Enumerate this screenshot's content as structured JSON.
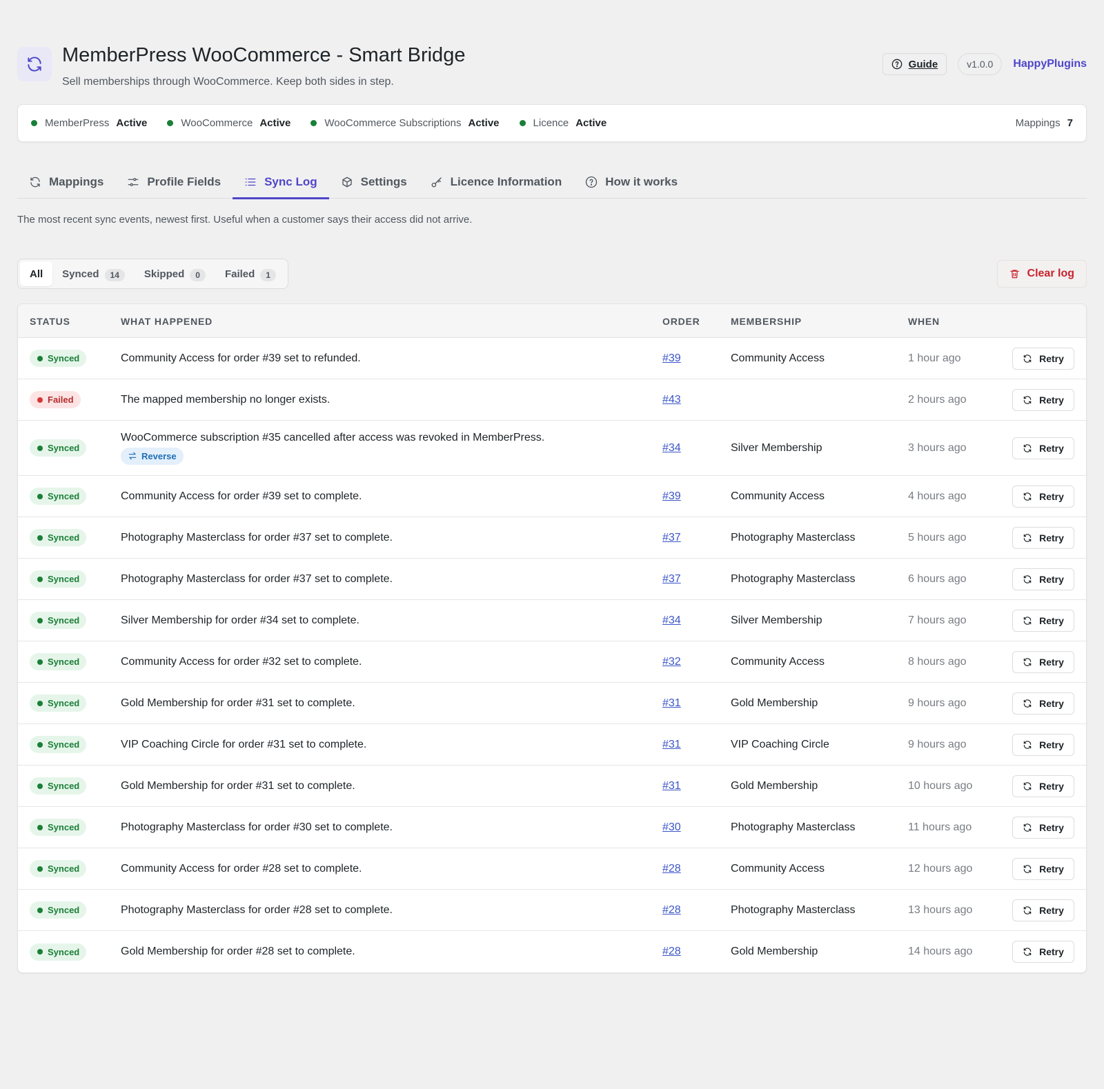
{
  "header": {
    "title": "MemberPress WooCommerce - Smart Bridge",
    "subtitle": "Sell memberships through WooCommerce. Keep both sides in step.",
    "guide_label": "Guide",
    "version": "v1.0.0",
    "brand": "HappyPlugins"
  },
  "status": {
    "items": [
      {
        "name": "MemberPress",
        "value": "Active"
      },
      {
        "name": "WooCommerce",
        "value": "Active"
      },
      {
        "name": "WooCommerce Subscriptions",
        "value": "Active"
      },
      {
        "name": "Licence",
        "value": "Active"
      }
    ],
    "mappings_label": "Mappings",
    "mappings_count": "7"
  },
  "tabs": [
    {
      "label": "Mappings",
      "icon": "sync-icon"
    },
    {
      "label": "Profile Fields",
      "icon": "sliders-icon"
    },
    {
      "label": "Sync Log",
      "icon": "list-icon",
      "active": true
    },
    {
      "label": "Settings",
      "icon": "box-icon"
    },
    {
      "label": "Licence Information",
      "icon": "key-icon"
    },
    {
      "label": "How it works",
      "icon": "help-icon"
    }
  ],
  "intro": "The most recent sync events, newest first. Useful when a customer says their access did not arrive.",
  "filters": [
    {
      "label": "All",
      "active": true
    },
    {
      "label": "Synced",
      "count": "14"
    },
    {
      "label": "Skipped",
      "count": "0"
    },
    {
      "label": "Failed",
      "count": "1"
    }
  ],
  "clear_label": "Clear log",
  "table": {
    "headers": {
      "status": "STATUS",
      "what": "WHAT HAPPENED",
      "order": "ORDER",
      "membership": "MEMBERSHIP",
      "when": "WHEN"
    },
    "retry_label": "Retry",
    "reverse_label": "Reverse",
    "rows": [
      {
        "status": "Synced",
        "what": "Community Access for order #39 set to refunded.",
        "order": "#39",
        "membership": "Community Access",
        "when": "1 hour ago"
      },
      {
        "status": "Failed",
        "what": "The mapped membership no longer exists.",
        "order": "#43",
        "membership": "",
        "when": "2 hours ago"
      },
      {
        "status": "Synced",
        "what": "WooCommerce subscription #35 cancelled after access was revoked in MemberPress.",
        "reverse": true,
        "order": "#34",
        "membership": "Silver Membership",
        "when": "3 hours ago"
      },
      {
        "status": "Synced",
        "what": "Community Access for order #39 set to complete.",
        "order": "#39",
        "membership": "Community Access",
        "when": "4 hours ago"
      },
      {
        "status": "Synced",
        "what": "Photography Masterclass for order #37 set to complete.",
        "order": "#37",
        "membership": "Photography Masterclass",
        "when": "5 hours ago"
      },
      {
        "status": "Synced",
        "what": "Photography Masterclass for order #37 set to complete.",
        "order": "#37",
        "membership": "Photography Masterclass",
        "when": "6 hours ago"
      },
      {
        "status": "Synced",
        "what": "Silver Membership for order #34 set to complete.",
        "order": "#34",
        "membership": "Silver Membership",
        "when": "7 hours ago"
      },
      {
        "status": "Synced",
        "what": "Community Access for order #32 set to complete.",
        "order": "#32",
        "membership": "Community Access",
        "when": "8 hours ago"
      },
      {
        "status": "Synced",
        "what": "Gold Membership for order #31 set to complete.",
        "order": "#31",
        "membership": "Gold Membership",
        "when": "9 hours ago"
      },
      {
        "status": "Synced",
        "what": "VIP Coaching Circle for order #31 set to complete.",
        "order": "#31",
        "membership": "VIP Coaching Circle",
        "when": "9 hours ago"
      },
      {
        "status": "Synced",
        "what": "Gold Membership for order #31 set to complete.",
        "order": "#31",
        "membership": "Gold Membership",
        "when": "10 hours ago"
      },
      {
        "status": "Synced",
        "what": "Photography Masterclass for order #30 set to complete.",
        "order": "#30",
        "membership": "Photography Masterclass",
        "when": "11 hours ago"
      },
      {
        "status": "Synced",
        "what": "Community Access for order #28 set to complete.",
        "order": "#28",
        "membership": "Community Access",
        "when": "12 hours ago"
      },
      {
        "status": "Synced",
        "what": "Photography Masterclass for order #28 set to complete.",
        "order": "#28",
        "membership": "Photography Masterclass",
        "when": "13 hours ago"
      },
      {
        "status": "Synced",
        "what": "Gold Membership for order #28 set to complete.",
        "order": "#28",
        "membership": "Gold Membership",
        "when": "14 hours ago"
      }
    ]
  }
}
